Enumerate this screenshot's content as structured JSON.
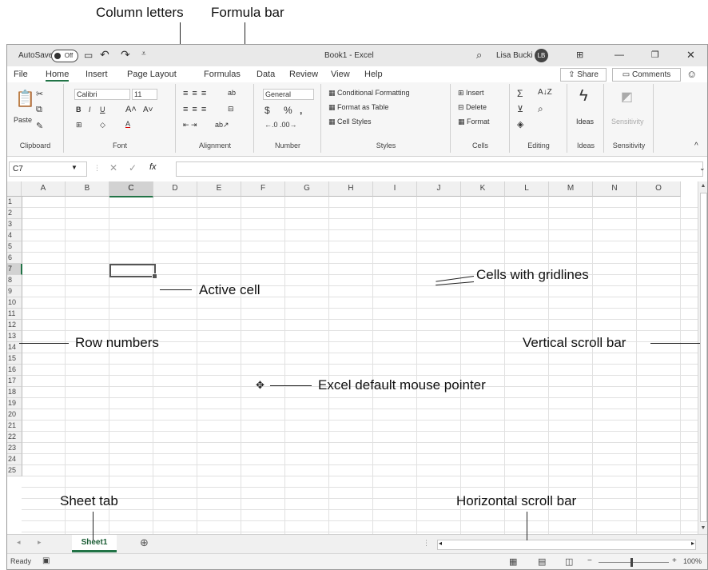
{
  "callouts": {
    "column_letters": "Column letters",
    "formula_bar": "Formula bar",
    "active_cell": "Active cell",
    "cells_with_gridlines": "Cells with gridlines",
    "row_numbers": "Row numbers",
    "vertical_scroll_bar": "Vertical scroll bar",
    "mouse_pointer": "Excel default mouse pointer",
    "sheet_tab": "Sheet tab",
    "horizontal_scroll_bar": "Horizontal scroll bar"
  },
  "titlebar": {
    "autosave": "AutoSave",
    "toggle": "Off",
    "title": "Book1 - Excel",
    "user": "Lisa Bucki",
    "initials": "LB"
  },
  "menu": [
    "File",
    "Home",
    "Insert",
    "Page Layout",
    "Formulas",
    "Data",
    "Review",
    "View",
    "Help"
  ],
  "share_label": "Share",
  "comments_label": "Comments",
  "ribbon": {
    "paste": "Paste",
    "clipboard": "Clipboard",
    "font_name": "Calibri",
    "font_size": "11",
    "font": "Font",
    "alignment": "Alignment",
    "number_format": "General",
    "number": "Number",
    "conditional_formatting": "Conditional Formatting",
    "format_as_table": "Format as Table",
    "cell_styles": "Cell Styles",
    "styles": "Styles",
    "insert": "Insert",
    "delete": "Delete",
    "format": "Format",
    "cells": "Cells",
    "editing": "Editing",
    "ideas": "Ideas",
    "sensitivity": "Sensitivity"
  },
  "name_box": "C7",
  "columns": [
    "A",
    "B",
    "C",
    "D",
    "E",
    "F",
    "G",
    "H",
    "I",
    "J",
    "K",
    "L",
    "M",
    "N",
    "O"
  ],
  "rows": [
    "1",
    "2",
    "3",
    "4",
    "5",
    "6",
    "7",
    "8",
    "9",
    "10",
    "11",
    "12",
    "13",
    "14",
    "15",
    "16",
    "17",
    "18",
    "19",
    "20",
    "21",
    "22",
    "23",
    "24",
    "25"
  ],
  "sheet_tab": "Sheet1",
  "status": "Ready",
  "zoom": "100%"
}
